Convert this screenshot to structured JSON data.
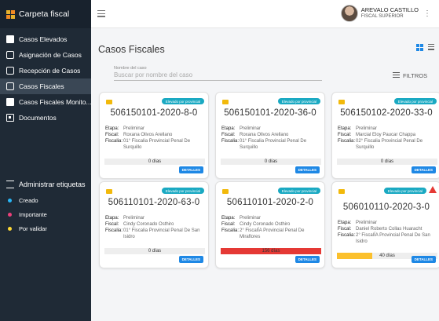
{
  "sidebar": {
    "brand": "Carpeta fiscal",
    "items": [
      {
        "label": "Casos Elevados"
      },
      {
        "label": "Asignación de Casos"
      },
      {
        "label": "Recepción de Casos"
      },
      {
        "label": "Casos Fiscales"
      },
      {
        "label": "Casos Fiscales Monito..."
      },
      {
        "label": "Documentos"
      }
    ],
    "section_title": "Administrar etiquetas",
    "tags": [
      {
        "label": "Creado",
        "color": "#29b6f6"
      },
      {
        "label": "Importante",
        "color": "#ec407a"
      },
      {
        "label": "Por validar",
        "color": "#fdd835"
      }
    ]
  },
  "header": {
    "user_name": "AREVALO CASTILLO",
    "user_role": "FISCAL SUPERIOR"
  },
  "main": {
    "title": "Casos Fiscales",
    "search_label": "Nombre del caso",
    "search_placeholder": "Buscar por nombre del caso",
    "filters_label": "FILTROS"
  },
  "labels": {
    "etapa": "Etapa:",
    "fiscal": "Fiscal:",
    "fiscalia": "Fiscalia:",
    "details": "DETALLES"
  },
  "cards": [
    {
      "badge": "Elevado por provincial",
      "case_number": "506150101-2020-8-0",
      "etapa": "Preliminar",
      "fiscal": "Roxana Olivos Arellano",
      "fiscalia": "01° Fiscalia Provincial Penal De Surquillo",
      "days": "0 días",
      "progress": 0,
      "bar_color": "#e0e0e0",
      "alert": false
    },
    {
      "badge": "Elevado por provincial",
      "case_number": "506150101-2020-36-0",
      "etapa": "Preliminar",
      "fiscal": "Roxana Olivos Arellano",
      "fiscalia": "01° Fiscalia Provincial Penal De Surquillo",
      "days": "0 días",
      "progress": 0,
      "bar_color": "#e0e0e0",
      "alert": false
    },
    {
      "badge": "Elevado por provincial",
      "case_number": "506150102-2020-33-0",
      "etapa": "Preliminar",
      "fiscal": "Marcial Eloy Paucar Chappa",
      "fiscalia": "02° Fiscalia Provincial Penal De Surquillo",
      "days": "0 días",
      "progress": 0,
      "bar_color": "#e0e0e0",
      "alert": false
    },
    {
      "badge": "Elevado por provincial",
      "case_number": "506110101-2020-63-0",
      "etapa": "Preliminar",
      "fiscal": "Cindy Coronado Osthiro",
      "fiscalia": "01° Fiscalia Provincial Penal De San Isidro",
      "days": "0 días",
      "progress": 0,
      "bar_color": "#e0e0e0",
      "alert": false
    },
    {
      "badge": "Elevado por provincial",
      "case_number": "506110101-2020-2-0",
      "etapa": "Preliminar",
      "fiscal": "Cindy Coronado Osthiro",
      "fiscalia": "2° FiscalÍA Provincial Penal De Miraflores",
      "days": "156 días",
      "progress": 1.0,
      "bar_color": "#e53935",
      "alert": false
    },
    {
      "badge": "Elevado por provincial",
      "case_number": "506010110-2020-3-0",
      "etapa": "Preliminar",
      "fiscal": "Daniel Roberto Collas Huaracht",
      "fiscalia": "2° FiscalÍA Provincial Penal De San Isidro",
      "days": "40 días",
      "progress": 0.35,
      "bar_color": "#fbc02d",
      "alert": true
    }
  ]
}
